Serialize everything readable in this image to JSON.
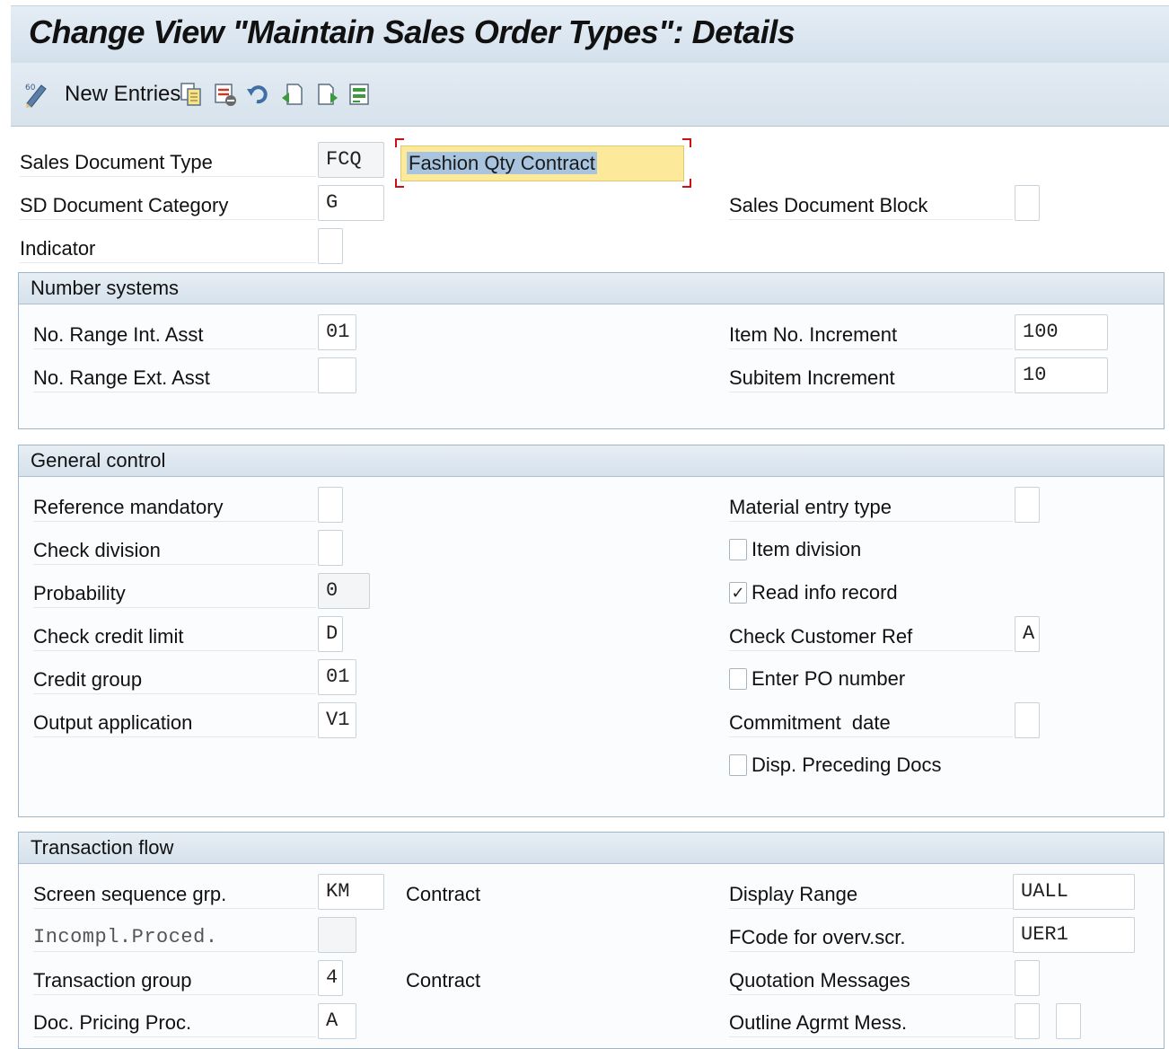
{
  "title": "Change View \"Maintain Sales Order Types\": Details",
  "toolbar": {
    "new_entries_label": "New Entries",
    "icons": [
      "change-display-icon",
      "copy-icon",
      "delete-icon",
      "undo-icon",
      "previous-entry-icon",
      "next-entry-icon",
      "select-all-icon"
    ]
  },
  "header": {
    "sales_doc_type_label": "Sales Document Type",
    "sales_doc_type_value": "FCQ",
    "sales_doc_type_desc": "Fashion Qty Contract",
    "sd_doc_category_label": "SD Document Category",
    "sd_doc_category_value": "G",
    "sales_doc_block_label": "Sales Document Block",
    "sales_doc_block_value": "",
    "indicator_label": "Indicator",
    "indicator_value": ""
  },
  "number_systems": {
    "title": "Number systems",
    "int_asst_label": "No. Range Int. Asst",
    "int_asst_value": "01",
    "ext_asst_label": "No. Range Ext. Asst",
    "ext_asst_value": "",
    "item_inc_label": "Item No. Increment",
    "item_inc_value": "100",
    "subitem_inc_label": "Subitem Increment",
    "subitem_inc_value": "10"
  },
  "general_control": {
    "title": "General control",
    "ref_mandatory_label": "Reference mandatory",
    "ref_mandatory_value": "",
    "check_division_label": "Check division",
    "check_division_value": "",
    "probability_label": "Probability",
    "probability_value": "0",
    "check_credit_label": "Check credit limit",
    "check_credit_value": "D",
    "credit_group_label": "Credit group",
    "credit_group_value": "01",
    "output_app_label": "Output application",
    "output_app_value": "V1",
    "material_entry_label": "Material entry type",
    "material_entry_value": "",
    "item_division_label": "Item division",
    "item_division_checked": false,
    "read_info_label": "Read info record",
    "read_info_checked": true,
    "check_cust_ref_label": "Check Customer Ref",
    "check_cust_ref_value": "A",
    "enter_po_label": "Enter PO number",
    "enter_po_checked": false,
    "commitment_date_label": "Commitment  date",
    "commitment_date_value": "",
    "disp_preceding_label": "Disp. Preceding Docs",
    "disp_preceding_checked": false,
    "check_mark": "✓"
  },
  "transaction_flow": {
    "title": "Transaction flow",
    "screen_seq_label": "Screen sequence grp.",
    "screen_seq_value": "KM",
    "screen_seq_desc": "Contract",
    "incompl_label": "Incompl.Proced.",
    "incompl_value": "",
    "trans_group_label": "Transaction group",
    "trans_group_value": "4",
    "trans_group_desc": "Contract",
    "doc_pricing_label": "Doc. Pricing Proc.",
    "doc_pricing_value": "A",
    "display_range_label": "Display Range",
    "display_range_value": "UALL",
    "fcode_label": "FCode for overv.scr.",
    "fcode_value": "UER1",
    "quotation_msg_label": "Quotation Messages",
    "quotation_msg_value": "",
    "outline_agrmt_label": "Outline Agrmt Mess.",
    "outline_agrmt_value1": "",
    "outline_agrmt_value2": ""
  },
  "colors": {
    "header_bg": "#dce6f0",
    "group_border": "#9fb6cc",
    "highlight_field": "#fde99a",
    "focus_corner": "#d01010"
  }
}
